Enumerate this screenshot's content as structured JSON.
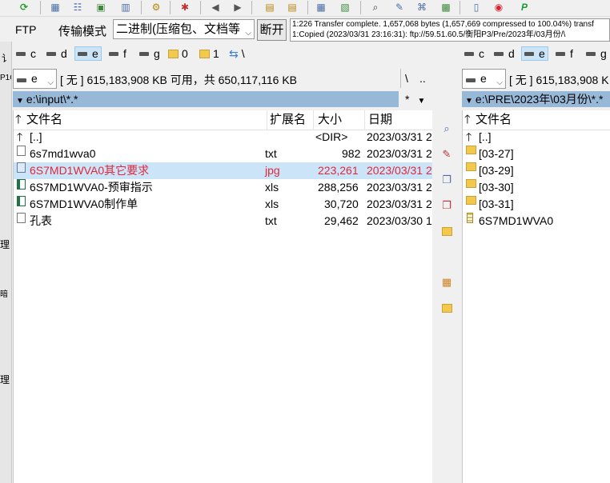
{
  "toolbar": {
    "icons": [
      "refresh-icon",
      "grid-icon",
      "tree-icon",
      "picture-icon",
      "folder-compare-icon",
      "select-icon",
      "separator",
      "back-icon",
      "forward-icon",
      "pack-icon",
      "unpack-icon",
      "compare-icon",
      "find-icon",
      "sync-icon",
      "multi-rename-icon",
      "notepad-icon",
      "copy-icon",
      "chrome-icon",
      "parking-icon"
    ]
  },
  "ftp": {
    "label": "FTP",
    "mode_label": "传输模式",
    "mode_value": "二进制(压缩包、文档等",
    "disconnect_label": "断开",
    "log_line1": "1:226 Transfer complete. 1,657,068 bytes (1,657,669 compressed to 100.04%) transf",
    "log_line2": "1:Copied (2023/03/31 23:16:31): ftp://59.51.60.5/衡阳P3/Pre/2023年/03月份/\\"
  },
  "left_drives": {
    "items": [
      "c",
      "d",
      "e",
      "f",
      "g",
      "0",
      "1",
      "\\"
    ],
    "selected": "e"
  },
  "right_drives": {
    "items": [
      "c",
      "d",
      "e",
      "f",
      "g"
    ],
    "selected": "e"
  },
  "left_panel": {
    "drive_value": "e",
    "free_space": "[ 无 ]  615,183,908 KB 可用，共 650,117,116 KB",
    "root_btn": "\\",
    "up_btn": "..",
    "path": "e:\\input\\*.*",
    "filter": "*",
    "columns": {
      "name": "文件名",
      "ext": "扩展名",
      "size": "大小",
      "date": "日期"
    },
    "rows": [
      {
        "name": "[..]",
        "ext": "",
        "size": "<DIR>",
        "date": "2023/03/31 2",
        "type": "up"
      },
      {
        "name": "6s7md1wva0",
        "ext": "txt",
        "size": "982",
        "date": "2023/03/31 2",
        "type": "file"
      },
      {
        "name": "6S7MD1WVA0其它要求",
        "ext": "jpg",
        "size": "223,261",
        "date": "2023/03/31 2",
        "type": "jpg"
      },
      {
        "name": "6S7MD1WVA0-预审指示",
        "ext": "xls",
        "size": "288,256",
        "date": "2023/03/31 2",
        "type": "xls"
      },
      {
        "name": "6S7MD1WVA0制作单",
        "ext": "xls",
        "size": "30,720",
        "date": "2023/03/31 2",
        "type": "xls"
      },
      {
        "name": "孔表",
        "ext": "txt",
        "size": "29,462",
        "date": "2023/03/30 1",
        "type": "file"
      }
    ]
  },
  "right_panel": {
    "drive_value": "e",
    "free_space": "[ 无 ]  615,183,908 K",
    "path": "e:\\PRE\\2023年\\03月份\\*.*",
    "columns": {
      "name": "文件名"
    },
    "rows": [
      {
        "name": "[..]",
        "type": "up"
      },
      {
        "name": "[03-27]",
        "type": "folder"
      },
      {
        "name": "[03-29]",
        "type": "folder"
      },
      {
        "name": "[03-30]",
        "type": "folder"
      },
      {
        "name": "[03-31]",
        "type": "folder"
      },
      {
        "name": "6S7MD1WVA0",
        "type": "zip"
      }
    ]
  },
  "left_edge": {
    "text1": "讠",
    "text2": "P1C",
    "text3": "理",
    "text4": "暗",
    "text5": "理"
  },
  "colors": {
    "path_bar": "#98b8d8",
    "selection": "#cce4f7",
    "highlight_text": "#e0283c"
  }
}
